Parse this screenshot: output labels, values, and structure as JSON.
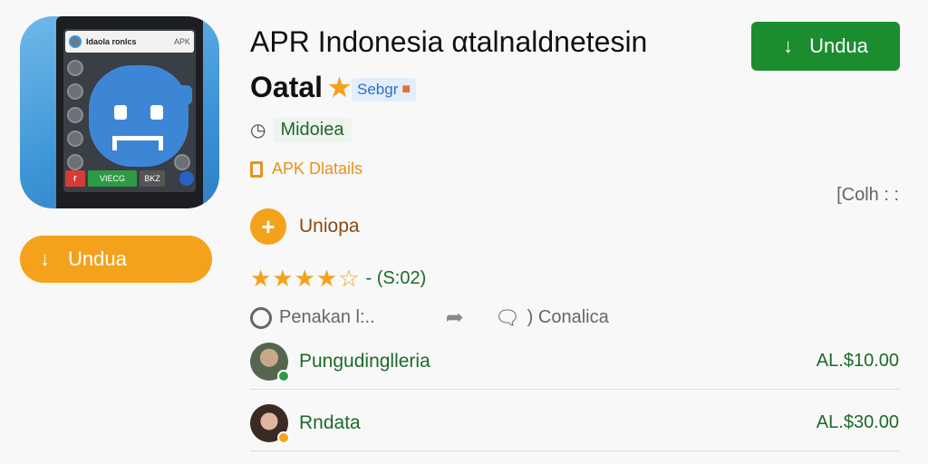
{
  "app_icon": {
    "screen_title": "Idaola ronlcs",
    "screen_label": "APK",
    "bottom_red_glyph": "ғ",
    "bottom_green_text": "VIECG",
    "bottom_dark_text": "BKZ"
  },
  "title": {
    "line1": "APR Indonesia αtalnaldnetesin",
    "line2": "Oatal",
    "badge": "Sebgr"
  },
  "download_green": {
    "label": "Undua"
  },
  "download_orange": {
    "label": "Undua"
  },
  "developer": {
    "value": "Midoiea"
  },
  "details": {
    "label": "APK Dlatails"
  },
  "count": {
    "value": "[Colh : :"
  },
  "update": {
    "label": "Uniopa"
  },
  "rating": {
    "stars": "★★★★☆",
    "value": "- (S:02)"
  },
  "actions": {
    "left": "Penakan l:..",
    "right": ") Conalica"
  },
  "list": [
    {
      "name": "Pungudinglleria",
      "price": "AL.$10.00"
    },
    {
      "name": "Rndata",
      "price": "AL.$30.00"
    }
  ],
  "colors": {
    "green": "#1c8d2e",
    "orange": "#f4a21c"
  }
}
